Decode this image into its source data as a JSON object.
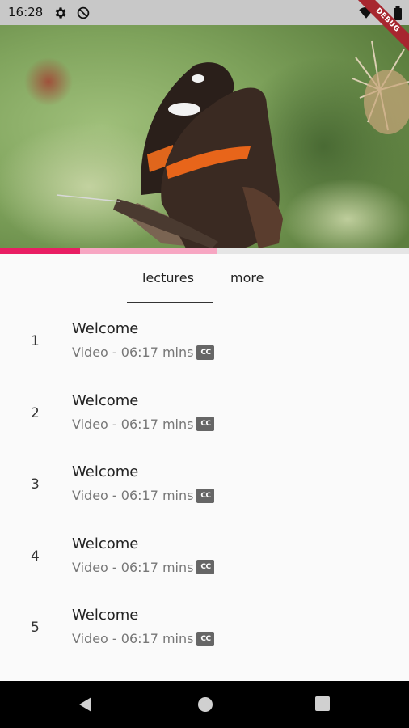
{
  "status_bar": {
    "time": "16:28",
    "icons": [
      "gear-icon",
      "sync-off-icon",
      "wifi-icon",
      "battery-icon"
    ]
  },
  "debug_banner": "DEBUG",
  "video": {
    "subject": "butterfly-thumbnail",
    "progress_played": 0.195,
    "progress_buffered": 0.53
  },
  "tabs": [
    {
      "label": "lectures",
      "selected": true
    },
    {
      "label": "more",
      "selected": false
    }
  ],
  "lectures": [
    {
      "number": "1",
      "title": "Welcome",
      "meta": "Video - 06:17 mins",
      "cc": "CC"
    },
    {
      "number": "2",
      "title": "Welcome",
      "meta": "Video - 06:17 mins",
      "cc": "CC"
    },
    {
      "number": "3",
      "title": "Welcome",
      "meta": "Video - 06:17 mins",
      "cc": "CC"
    },
    {
      "number": "4",
      "title": "Welcome",
      "meta": "Video - 06:17 mins",
      "cc": "CC"
    },
    {
      "number": "5",
      "title": "Welcome",
      "meta": "Video - 06:17 mins",
      "cc": "CC"
    }
  ],
  "nav_bar": {
    "icons": [
      "back-icon",
      "home-icon",
      "recents-icon"
    ]
  },
  "colors": {
    "accent": "#e91e63",
    "buffer": "#f7a6c2",
    "status_bar": "#c8c8c8",
    "nav_bar": "#000000",
    "debug_banner": "#a7262f"
  }
}
